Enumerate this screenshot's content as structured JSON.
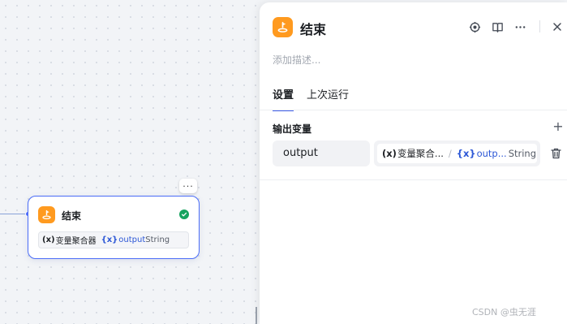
{
  "canvas": {
    "node": {
      "title": "结束",
      "more_label": "···",
      "var_tag_prefix": "(x)",
      "var_tag_label": "变量聚合器",
      "var_field_prefix": "{x}",
      "var_field_name": "output",
      "var_type": "String"
    }
  },
  "panel": {
    "title": "结束",
    "description_placeholder": "添加描述...",
    "tabs": [
      {
        "label": "设置",
        "active": true
      },
      {
        "label": "上次运行",
        "active": false
      }
    ],
    "output_section": {
      "title": "输出变量",
      "add_label": "+",
      "rows": [
        {
          "name": "output",
          "ref_tag_prefix": "(x)",
          "ref_tag_label": "变量聚合...",
          "ref_separator": "/",
          "ref_field_prefix": "{x}",
          "ref_field_name": "outp...",
          "ref_type": "String"
        }
      ]
    }
  },
  "watermark": "CSDN @虫无涯",
  "colors": {
    "accent": "#4a6cf7",
    "node_icon": "#ff9a1f",
    "success": "#16a35f",
    "field_text": "#2c57d6"
  },
  "icons": [
    "end-node-icon",
    "check-icon",
    "locate-icon",
    "book-icon",
    "more-icon",
    "close-icon",
    "plus-icon",
    "trash-icon"
  ]
}
